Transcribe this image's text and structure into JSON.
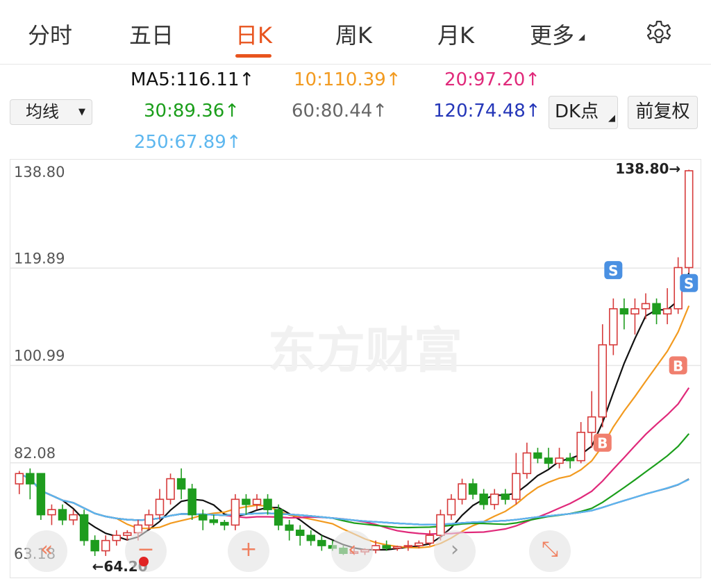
{
  "tabs": [
    {
      "label": "分时",
      "active": false
    },
    {
      "label": "五日",
      "active": false
    },
    {
      "label": "日K",
      "active": true
    },
    {
      "label": "周K",
      "active": false
    },
    {
      "label": "月K",
      "active": false
    },
    {
      "label": "更多",
      "active": false
    }
  ],
  "icons": {
    "settings": "gear-icon",
    "more_dropdown": "triangle-down-icon"
  },
  "controls": {
    "ma_select": "均线",
    "dk_button": "DK点",
    "fq_button": "前复权"
  },
  "ma_legend": [
    {
      "label": "MA5:116.11↑",
      "color": "#111111"
    },
    {
      "label": "10:110.39↑",
      "color": "#f29a1f"
    },
    {
      "label": "20:97.20↑",
      "color": "#e0297a"
    },
    {
      "label": "30:89.36↑",
      "color": "#1b9e1b"
    },
    {
      "label": "60:80.44↑",
      "color": "#666666"
    },
    {
      "label": "120:74.48↑",
      "color": "#2436b8"
    },
    {
      "label": "250:67.89↑",
      "color": "#5db7ef"
    }
  ],
  "watermark": "东方财富",
  "zoom_controls": [
    {
      "icon": "double-left-arrow-icon",
      "symbol": "«"
    },
    {
      "icon": "minus-icon",
      "symbol": "−"
    },
    {
      "icon": "plus-icon",
      "symbol": "+"
    },
    {
      "icon": "left-arrow-icon",
      "symbol": "‹"
    },
    {
      "icon": "right-arrow-icon",
      "symbol": "›"
    },
    {
      "icon": "expand-icon",
      "symbol": "⤡"
    }
  ],
  "chart_data": {
    "type": "candlestick",
    "ylim": [
      63.18,
      138.8
    ],
    "y_tick_labels": [
      "138.80",
      "119.89",
      "100.99",
      "82.08",
      "63.18"
    ],
    "max_label": "138.80→",
    "min_label": "←64.20",
    "colors": {
      "up": "#d63a3a",
      "down": "#1e9c1e"
    },
    "candles": [
      [
        78,
        80,
        76,
        80.5
      ],
      [
        80,
        78,
        75,
        81
      ],
      [
        80,
        72,
        71,
        80
      ],
      [
        72,
        73,
        70,
        74
      ],
      [
        73,
        71,
        70,
        74
      ],
      [
        71,
        72,
        70,
        73
      ],
      [
        72,
        67,
        66,
        73
      ],
      [
        67,
        65,
        64,
        68
      ],
      [
        65,
        67,
        64,
        68
      ],
      [
        67,
        68,
        66,
        69
      ],
      [
        68,
        68.5,
        67,
        69
      ],
      [
        68.5,
        70,
        67,
        71
      ],
      [
        70,
        72,
        69,
        73
      ],
      [
        72,
        75,
        71,
        77
      ],
      [
        75,
        79,
        74,
        80
      ],
      [
        79,
        77,
        75,
        81
      ],
      [
        77,
        72,
        71,
        78
      ],
      [
        72,
        71,
        69,
        73
      ],
      [
        71,
        70.5,
        70,
        72
      ],
      [
        70.5,
        70,
        69,
        71
      ],
      [
        70,
        75,
        69,
        76
      ],
      [
        75,
        74,
        72,
        76
      ],
      [
        74,
        75,
        73,
        76
      ],
      [
        75,
        73,
        72,
        76
      ],
      [
        73,
        70,
        69,
        74
      ],
      [
        70,
        69,
        67,
        71
      ],
      [
        69,
        68,
        66,
        70
      ],
      [
        68,
        67,
        66,
        69
      ],
      [
        67,
        66,
        65,
        68
      ],
      [
        66,
        65.5,
        65,
        67
      ],
      [
        65.5,
        64.5,
        64.2,
        66
      ],
      [
        64.5,
        64.8,
        64.2,
        66
      ],
      [
        64.8,
        65.2,
        64.2,
        65.5
      ],
      [
        65.2,
        66,
        64.5,
        67
      ],
      [
        66,
        65.5,
        65,
        67
      ],
      [
        65.5,
        65.8,
        65,
        66
      ],
      [
        65.8,
        66,
        65,
        67
      ],
      [
        66,
        66.5,
        65.5,
        67
      ],
      [
        66.5,
        68,
        66,
        69
      ],
      [
        68,
        72,
        67,
        73
      ],
      [
        72,
        75,
        71,
        76
      ],
      [
        75,
        78,
        74,
        79
      ],
      [
        78,
        76,
        75,
        79
      ],
      [
        76,
        74,
        73,
        77
      ],
      [
        74,
        76,
        73,
        77
      ],
      [
        76,
        75,
        74,
        77
      ],
      [
        75,
        80,
        74,
        84
      ],
      [
        80,
        84,
        79,
        86
      ],
      [
        84,
        83,
        82,
        85
      ],
      [
        83,
        82,
        81,
        85
      ],
      [
        82,
        83,
        81,
        85
      ],
      [
        83,
        82.5,
        81,
        84
      ],
      [
        82.5,
        88,
        82,
        90
      ],
      [
        88,
        91,
        85,
        96
      ],
      [
        91,
        105,
        89,
        109
      ],
      [
        105,
        112,
        103,
        114
      ],
      [
        112,
        111,
        108,
        114
      ],
      [
        111,
        112,
        107,
        114
      ],
      [
        112,
        113,
        110,
        115
      ],
      [
        113,
        111,
        109,
        114
      ],
      [
        111,
        112,
        109,
        116
      ],
      [
        112,
        120,
        111,
        122
      ],
      [
        120,
        138.8,
        119,
        139
      ]
    ],
    "markers": [
      {
        "label": "S",
        "index": 55,
        "price": 119.5,
        "color": "#4a90e2"
      },
      {
        "label": "S",
        "index": 62,
        "price": 117,
        "color": "#4a90e2"
      },
      {
        "label": "B",
        "index": 54,
        "price": 86,
        "color": "#f07f6e"
      },
      {
        "label": "B",
        "index": 61,
        "price": 101,
        "color": "#f07f6e"
      }
    ]
  }
}
